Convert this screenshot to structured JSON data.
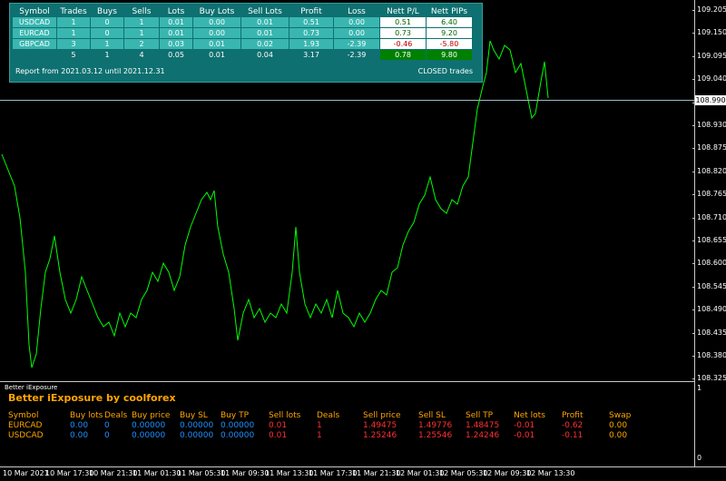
{
  "report": {
    "headers": [
      "Symbol",
      "Trades",
      "Buys",
      "Sells",
      "Lots",
      "Buy Lots",
      "Sell Lots",
      "Profit",
      "Loss",
      "Nett P/L",
      "Nett PIPs"
    ],
    "rows": [
      [
        "USDCAD",
        "1",
        "0",
        "1",
        "0.01",
        "0.00",
        "0.01",
        "0.51",
        "0.00",
        "0.51",
        "6.40"
      ],
      [
        "EURCAD",
        "1",
        "0",
        "1",
        "0.01",
        "0.00",
        "0.01",
        "0.73",
        "0.00",
        "0.73",
        "9.20"
      ],
      [
        "GBPCAD",
        "3",
        "1",
        "2",
        "0.03",
        "0.01",
        "0.02",
        "1.93",
        "-2.39",
        "-0.46",
        "-5.80"
      ]
    ],
    "totals": [
      "",
      "5",
      "1",
      "4",
      "0.05",
      "0.01",
      "0.04",
      "3.17",
      "-2.39",
      "0.78",
      "9.80"
    ],
    "range_text": "Report from 2021.03.12 until 2021.12.31",
    "mode_text": "CLOSED trades"
  },
  "price_axis": {
    "ticks": [
      "109.205",
      "109.150",
      "109.095",
      "109.040",
      "108.985",
      "108.930",
      "108.875",
      "108.820",
      "108.765",
      "108.710",
      "108.655",
      "108.600",
      "108.545",
      "108.490",
      "108.435",
      "108.380",
      "108.325"
    ],
    "current": "108.990"
  },
  "time_axis": {
    "ticks": [
      "10 Mar 2021",
      "10 Mar 17:30",
      "10 Mar 21:30",
      "11 Mar 01:30",
      "11 Mar 05:30",
      "11 Mar 09:30",
      "11 Mar 13:30",
      "11 Mar 17:30",
      "11 Mar 21:30",
      "12 Mar 01:30",
      "12 Mar 05:30",
      "12 Mar 09:30",
      "12 Mar 13:30"
    ]
  },
  "indicator": {
    "subwindow_title": "Better iExposure",
    "title": "Better iExposure by coolforex",
    "headers": [
      "Symbol",
      "Buy lots",
      "Deals",
      "Buy price",
      "Buy SL",
      "Buy TP",
      "Sell lots",
      "Deals",
      "Sell price",
      "Sell SL",
      "Sell TP",
      "Net lots",
      "Profit",
      "Swap"
    ],
    "rows": [
      [
        "EURCAD",
        "0.00",
        "0",
        "0.00000",
        "0.00000",
        "0.00000",
        "0.01",
        "1",
        "1.49475",
        "1.49776",
        "1.48475",
        "-0.01",
        "-0.62",
        "0.00"
      ],
      [
        "USDCAD",
        "0.00",
        "0",
        "0.00000",
        "0.00000",
        "0.00000",
        "0.01",
        "1",
        "1.25246",
        "1.25546",
        "1.24246",
        "-0.01",
        "-0.11",
        "0.00"
      ]
    ],
    "scale_top": "1",
    "scale_bottom": "0"
  },
  "colors": {
    "line": "#00ff00",
    "orange": "#ffa500",
    "blue": "#1e90ff",
    "red": "#ff3030"
  }
}
